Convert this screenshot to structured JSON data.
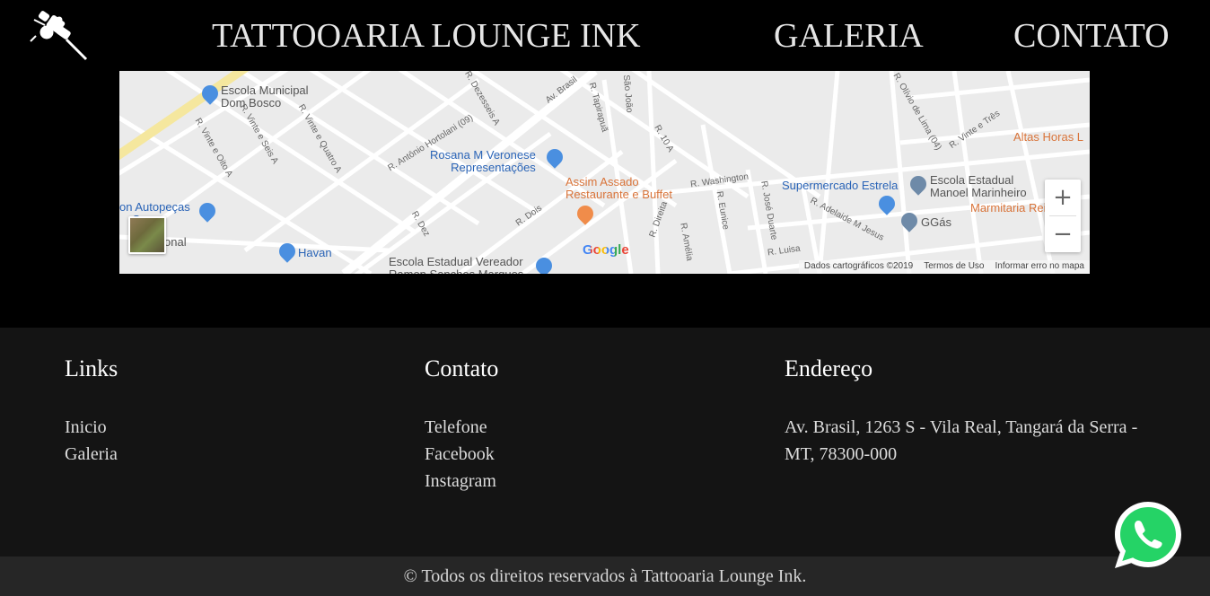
{
  "header": {
    "brand": "TATTOOARIA LOUNGE INK",
    "nav": [
      "GALERIA",
      "CONTATO"
    ]
  },
  "map": {
    "labels": {
      "escola_dom_bosco": "Escola Municipal\nDom Bosco",
      "rosana": "Rosana M Veronese\nRepresentações",
      "assim_assado": "Assim Assado\nRestaurante e Buffet",
      "supermercado": "Supermercado Estrela",
      "escola_manoel": "Escola Estadual\nManoel Marinheiro",
      "altas_horas": "Altas Horas L",
      "marmitaria": "Marmitaria Rei do",
      "ggas": "GGás",
      "autopecas": "on Autopeças\n    Serra",
      "havan": "Havan",
      "nacional": "onal",
      "escola_vereador": "Escola Estadual Vereador\nRamon Sanches Marques"
    },
    "streets": [
      "Av. Brasil",
      "R. Dezesseis A",
      "R. Tapirapuã",
      "R. Antônio Hortolani (09)",
      "R. Vinte e Oito A",
      "R. Vinte e Seis A",
      "R. Vinte e Quatro A",
      "R. 10 A",
      "R. Washington",
      "R. Olívio de Lima (04)",
      "R. Vinte e Três",
      "R. Dez",
      "R. Dois",
      "R. Direita",
      "R. Amélia",
      "R. Eunice",
      "R. José Duarte",
      "R. Adelaide M Jesus",
      "R. Luisa",
      "São João"
    ],
    "zoom_in": "+",
    "zoom_out": "−",
    "google": "Google",
    "attribution": [
      "Dados cartográficos ©2019",
      "Termos de Uso",
      "Informar erro no mapa"
    ]
  },
  "footer": {
    "links": {
      "title": "Links",
      "items": [
        "Inicio",
        "Galeria"
      ]
    },
    "contato": {
      "title": "Contato",
      "items": [
        "Telefone",
        "Facebook",
        "Instagram"
      ]
    },
    "endereco": {
      "title": "Endereço",
      "text": "Av. Brasil, 1263 S - Vila Real, Tangará da Serra - MT, 78300-000"
    },
    "copyright": "© Todos os direitos reservados à Tattooaria Lounge Ink."
  },
  "colors": {
    "background": "#000000",
    "footer": "#141414",
    "copyright_bar": "#262626",
    "whatsapp": "#25d366"
  },
  "icons": [
    "tattoo-machine-icon",
    "zoom-in-icon",
    "zoom-out-icon",
    "whatsapp-icon",
    "map-pin-icon"
  ]
}
